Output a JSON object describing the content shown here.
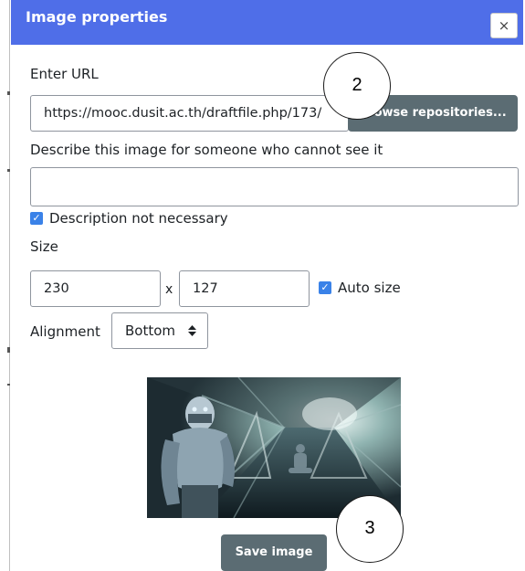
{
  "dialog": {
    "title": "Image properties",
    "close_label": "×"
  },
  "url": {
    "label": "Enter URL",
    "value": "https://mooc.dusit.ac.th/draftfile.php/173/",
    "browse_label": "Browse repositories..."
  },
  "description": {
    "label": "Describe this image for someone who cannot see it",
    "value": "",
    "not_necessary_label": "Description not necessary",
    "not_necessary_checked": true
  },
  "size": {
    "label": "Size",
    "width": "230",
    "separator": "x",
    "height": "127",
    "auto_size_label": "Auto size",
    "auto_size_checked": true
  },
  "alignment": {
    "label": "Alignment",
    "selected": "Bottom"
  },
  "save_label": "Save image",
  "annotations": {
    "callout_2": "2",
    "callout_3": "3"
  },
  "colors": {
    "header": "#4f6ee8",
    "button": "#5b6c73",
    "checkbox": "#3a82e8"
  }
}
